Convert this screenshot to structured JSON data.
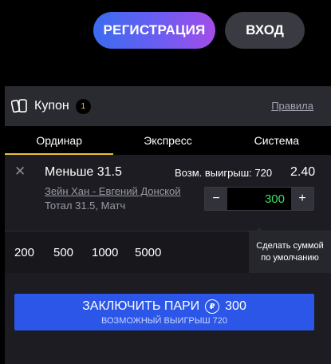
{
  "header": {
    "register_label": "РЕГИСТРАЦИЯ",
    "login_label": "ВХОД"
  },
  "coupon": {
    "title": "Купон",
    "count": "1",
    "rules_label": "Правила",
    "icon": "coupon-ticket-icon"
  },
  "tabs": [
    {
      "label": "Ординар",
      "active": true
    },
    {
      "label": "Экспресс",
      "active": false
    },
    {
      "label": "Система",
      "active": false
    }
  ],
  "bet": {
    "name": "Меньше 31.5",
    "possible_win": "Возм. выигрыш: 720",
    "odds": "2.40",
    "event": "Зейн Хан - Евгений Донской",
    "market": "Тотал 31.5, Матч",
    "stake": "300",
    "minus_label": "−",
    "plus_label": "+"
  },
  "quick_amounts": [
    "200",
    "500",
    "1000",
    "5000"
  ],
  "default_amount_label_line1": "Сделать суммой",
  "default_amount_label_line2": "по умолчанию",
  "place_bet": {
    "label": "ЗАКЛЮЧИТЬ ПАРИ",
    "amount": "300",
    "possible_win": "ВОЗМОЖНЫЙ ВЫИГРЫШ 720",
    "bonus_icon_glyph": "₽"
  },
  "colors": {
    "accent_tab": "#e8c23a",
    "stake_text": "#3ddc62",
    "place_button": "#2b56e8"
  }
}
